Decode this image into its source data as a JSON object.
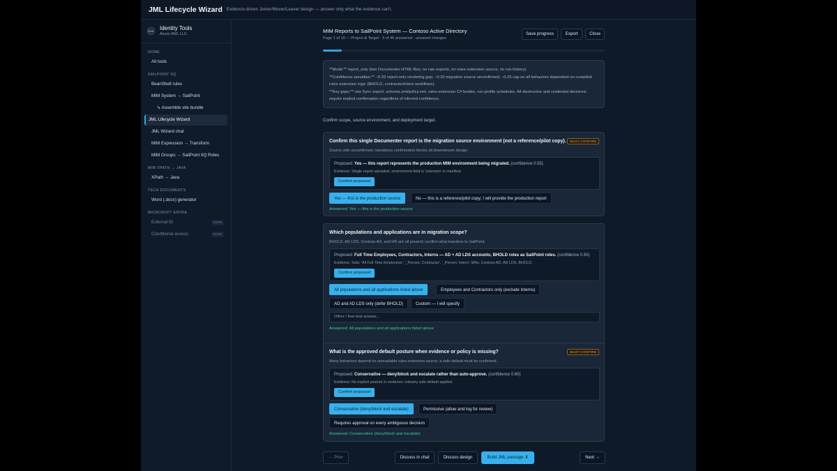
{
  "app": {
    "title": "JML Lifecycle Wizard",
    "subtitle": "Evidence-driven Joiner/Mover/Leaver design — answer only what the evidence can't."
  },
  "brand": {
    "logo_text": "E&E",
    "name": "Identity Tools",
    "org": "Azure IAM, LLC"
  },
  "sidebar": {
    "sections": [
      {
        "label": "HOME",
        "items": [
          {
            "label": "All tools"
          }
        ]
      },
      {
        "label": "SAILPOINT IIQ",
        "items": [
          {
            "label": "BeanShell rules"
          },
          {
            "label": "MIM System → SailPoint"
          },
          {
            "label": "↳ Assemble site bundle",
            "sub": true
          },
          {
            "label": "JML Lifecycle Wizard",
            "active": true
          },
          {
            "label": "JML Wizard chat"
          },
          {
            "label": "MIM Expression → Transform"
          },
          {
            "label": "MIM Groups → SailPoint IIQ Roles"
          }
        ]
      },
      {
        "label": "MIM XPATH → JAVA",
        "items": [
          {
            "label": "XPath → Java"
          }
        ]
      },
      {
        "label": "TECH DOCUMENTS",
        "items": [
          {
            "label": "Word (.docx) generator"
          }
        ]
      },
      {
        "label": "MICROSOFT ENTRA",
        "items": [
          {
            "label": "External ID",
            "disabled": true,
            "badge": "SOON"
          },
          {
            "label": "Conditional access",
            "disabled": true,
            "badge": "SOON"
          }
        ]
      }
    ]
  },
  "header": {
    "title": "MIM Reports to SailPoint System — Contoso Active Directory",
    "meta": "Page 1 of 10 — Project & Target · 3 of 46 answered · unsaved changes",
    "save_label": "Save progress",
    "export_label": "Export",
    "close_label": "Close"
  },
  "progress": {
    "fraction": 0.1
  },
  "notes": {
    "lines": [
      "**Mode:** report_only (two Documenter HTML files; no raw exports, no rules-extension source, no run-history).",
      "**Confidence penalties:** −0.20 report-only rendering gap; −0.20 migration source unconfirmed; −0.25 cap on all behaviors dependent on compiled rules-extension logic (BHOLD, contractor/intern workflows).",
      "**Key gaps:** raw Sync export, schema.xml/policy.xml, rules-extension C# bodies, run-profile schedules. All destructive and credential decisions require explicit confirmation regardless of inferred confidence."
    ]
  },
  "intro": "Confirm scope, source environment, and deployment target.",
  "questions": [
    {
      "title": "Confirm this single Documenter report is the migration source environment (not a reference/pilot copy).",
      "subtitle": "Source side unconfirmed; mandatory confirmation blocks all downstream design.",
      "badge": "MUST CONFIRM",
      "proposed_prefix": "Proposed: ",
      "proposed": "Yes — this report represents the production MIM environment being migrated.",
      "confidence": "(confidence 0.55)",
      "evidence": "Evidence: Single report uploaded; environment field is 'unknown' in manifest.",
      "confirm_label": "Confirm proposed",
      "options": [
        {
          "label": "Yes — this is the production source",
          "selected": true
        },
        {
          "label": "No — this is a reference/pilot copy; I will provide the production report",
          "selected": false
        }
      ],
      "answered": "Answered: Yes — this is the production source"
    },
    {
      "title": "Which populations and applications are in migration scope?",
      "subtitle": "BHOLD, AD LDS, Contoso AD, and HR are all present; confirm what transfers to SailPoint.",
      "proposed_prefix": "Proposed: ",
      "proposed": "Full Time Employees, Contractors, Interns — AD + AD LDS accounts; BHOLD roles as SailPoint roles.",
      "confidence": "(confidence 0.50)",
      "evidence": "Evidence: Sets: 'All Full Time Employees', '_Person: Contractor', '_Person: Intern'; MAs: Contoso AD, AD LDS, BHOLD.",
      "confirm_label": "Confirm proposed",
      "options": [
        {
          "label": "All populations and all applications listed above",
          "selected": true
        },
        {
          "label": "Employees and Contractors only (exclude Interns)",
          "selected": false
        },
        {
          "label": "AD and AD LDS only (defer BHOLD)",
          "selected": false
        },
        {
          "label": "Custom — I will specify",
          "selected": false
        }
      ],
      "freetext_placeholder": "Other / free-text answer...",
      "answered": "Answered: All populations and all applications listed above"
    },
    {
      "title": "What is the approved default posture when evidence or policy is missing?",
      "subtitle": "Many behaviors depend on unavailable rules-extension source; a safe default must be confirmed.",
      "badge": "MUST CONFIRM",
      "proposed_prefix": "Proposed: ",
      "proposed": "Conservative — deny/block and escalate rather than auto-approve.",
      "confidence": "(confidence 0.60)",
      "evidence": "Evidence: No explicit posture in evidence; industry safe-default applied.",
      "confirm_label": "Confirm proposed",
      "options": [
        {
          "label": "Conservative (deny/block and escalate)",
          "selected": true
        },
        {
          "label": "Permissive (allow and log for review)",
          "selected": false
        },
        {
          "label": "Requires approval on every ambiguous decision",
          "selected": false
        }
      ],
      "answered": "Answered: Conservative (deny/block and escalate)"
    }
  ],
  "footer": {
    "prev_label": "← Prev",
    "discuss_chat_label": "Discuss in chat",
    "discuss_design_label": "Discuss design",
    "build_label": "Build JML package ⬇",
    "next_label": "Next →"
  },
  "colors": {
    "accent": "#38b0ec",
    "answered": "#3fcf8e",
    "must_confirm": "#e0a24a",
    "panel": "#1a2738"
  }
}
